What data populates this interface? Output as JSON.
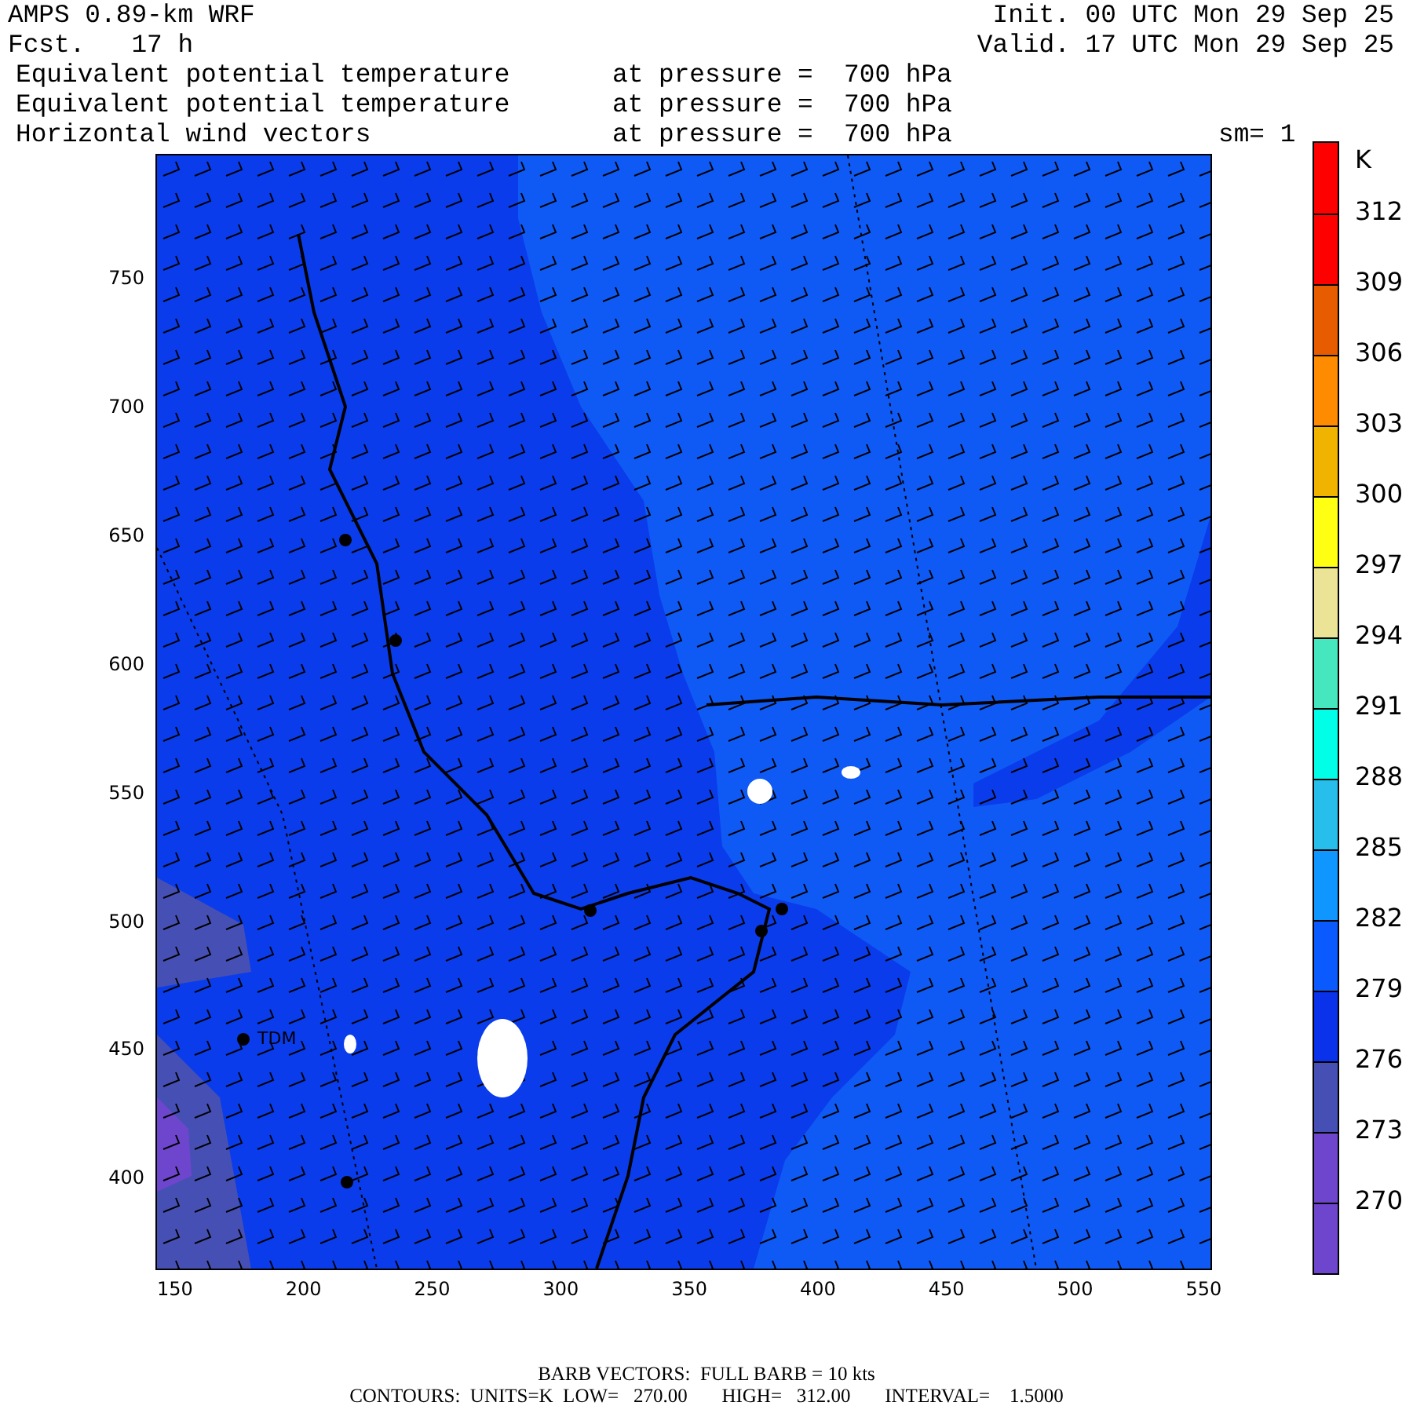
{
  "header": {
    "title": "AMPS 0.89-km WRF",
    "forecast": "Fcst.   17 h",
    "init": "Init. 00 UTC Mon 29 Sep 25",
    "valid": "Valid. 17 UTC Mon 29 Sep 25",
    "fields": [
      {
        "name": "Equivalent potential temperature",
        "level": "at pressure =  700 hPa"
      },
      {
        "name": "Equivalent potential temperature",
        "level": "at pressure =  700 hPa"
      },
      {
        "name": "Horizontal wind vectors",
        "level": "at pressure =  700 hPa"
      }
    ],
    "smoothing": "sm= 1"
  },
  "map": {
    "station_label": "TDM",
    "x_ticks": [
      "150",
      "200",
      "250",
      "300",
      "350",
      "400",
      "450",
      "500",
      "550"
    ],
    "y_ticks": [
      "750",
      "700",
      "650",
      "600",
      "550",
      "500",
      "450",
      "400"
    ]
  },
  "legend": {
    "unit": "K",
    "bins": [
      {
        "color": "#ff0000"
      },
      {
        "color": "#ff0000"
      },
      {
        "color": "#e85c00"
      },
      {
        "color": "#ff8c00"
      },
      {
        "color": "#f0b400"
      },
      {
        "color": "#ffff14"
      },
      {
        "color": "#ebe396"
      },
      {
        "color": "#46e6be"
      },
      {
        "color": "#00ffe6"
      },
      {
        "color": "#28beeb"
      },
      {
        "color": "#0f96ff"
      },
      {
        "color": "#0a5aff"
      },
      {
        "color": "#0a32eb"
      },
      {
        "color": "#4650b4"
      },
      {
        "color": "#6e46cd"
      },
      {
        "color": "#6e46cd"
      }
    ],
    "labels": [
      "312",
      "309",
      "306",
      "303",
      "300",
      "297",
      "294",
      "291",
      "288",
      "285",
      "282",
      "279",
      "276",
      "273",
      "270"
    ]
  },
  "footer": {
    "barbs": "BARB VECTORS:  FULL BARB = 10 kts",
    "contours": "CONTOURS:  UNITS=K  LOW=   270.00       HIGH=   312.00       INTERVAL=    1.5000"
  }
}
